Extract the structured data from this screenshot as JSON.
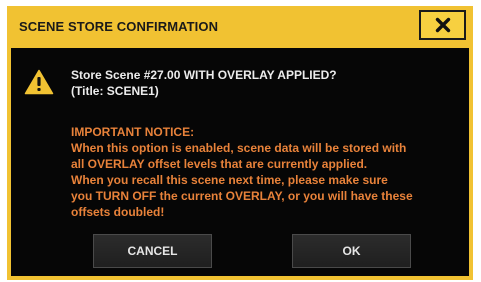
{
  "dialog": {
    "title": "SCENE STORE CONFIRMATION",
    "close_icon": "close-icon",
    "warning_icon": "warning-icon",
    "message_line1": "Store Scene #27.00 WITH OVERLAY APPLIED?",
    "message_line2": "(Title: SCENE1)",
    "notice_heading": "IMPORTANT NOTICE:",
    "notice_lines": [
      "When this option is enabled, scene data will be stored with",
      "all OVERLAY offset levels that are currently applied.",
      "When you recall this scene next time, please make sure",
      "you TURN OFF the current OVERLAY, or you will have these",
      "offsets doubled!"
    ],
    "cancel_label": "CANCEL",
    "ok_label": "OK"
  },
  "colors": {
    "title_bar": "#f1c232",
    "body_bg": "#060606",
    "notice_text": "#e8823a",
    "message_text": "#ececec"
  }
}
